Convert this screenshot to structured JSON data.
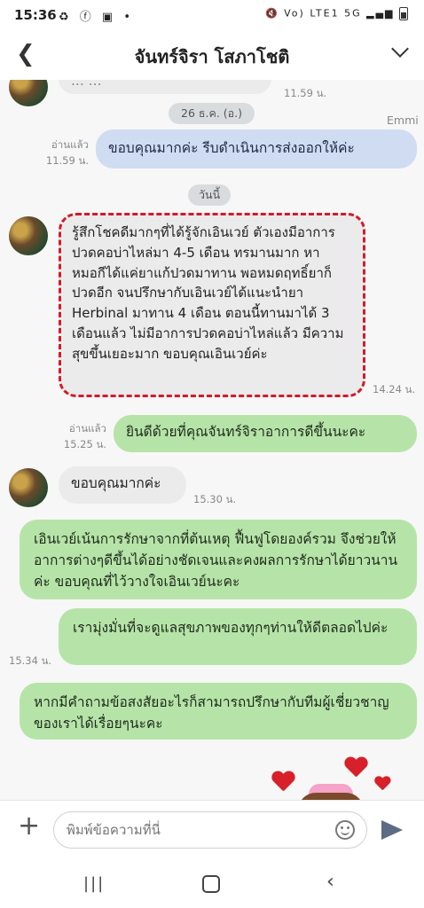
{
  "status": {
    "time": "15:36",
    "left_icons": "♻ ⓕ ▣ •",
    "right_icons": "🔇 Vo) LTE1 5G ▂▄▆"
  },
  "header": {
    "title": "จันทร์จิรา โสภาโชติ"
  },
  "messages": {
    "top_partial": "... ...",
    "top_time": "11.59 น.",
    "date1": "26 ธ.ค. (อ.)",
    "sender_name": "Emmi",
    "out1": {
      "read": "อ่านแล้ว",
      "time": "11.59 น.",
      "text": "ขอบคุณมากค่ะ  รีบดำเนินการส่งออกให้ค่ะ"
    },
    "date2": "วันนี้",
    "in_review": {
      "text": "รู้สึกโชคดีมากๆที่ได้รู้จักเอินเวย์ ตัวเองมีอาการปวดคอบ่าไหล่มา 4-5 เดือน ทรมานมาก หาหมอกีได้แค่ยาแก้ปวดมาทาน พอหมดฤทธิ์ยาก็ปวดอีก จนปรึกษากับเอินเวย์ได้แนะนำยา Herbinal มาทาน 4 เดือน ตอนนี้ทานมาได้ 3 เดือนแล้ว ไม่มีอาการปวดคอบ่าไหล่แล้ว มีความสุขขึ้นเยอะมาก ขอบคุณเอินเวย์ค่ะ",
      "time": "14.24 น."
    },
    "out2": {
      "read": "อ่านแล้ว",
      "time": "15.25 น.",
      "text": "ยินดีด้วยที่คุณจันทร์จิราอาการดีขึ้นนะคะ"
    },
    "in2": {
      "text": "ขอบคุณมากค่ะ",
      "time": "15.30 น."
    },
    "out3": {
      "text": "เอินเวย์เน้นการรักษาจากที่ต้นเหตุ ฟื้นฟูโดยองค์รวม จึงช่วยให้อาการต่างๆดีขึ้นได้อย่างชัดเจนและคงผลการรักษาได้ยาวนานค่ะ ขอบคุณที่ไว้วางใจเอินเวย์นะคะ"
    },
    "out4": {
      "text": "เรามุ่งมั่นที่จะดูแลสุขภาพของทุกๆท่านให้ดีตลอดไปค่ะ",
      "time": "15.34 น."
    },
    "out5": {
      "text": "หากมีคำถามข้อสงสัยอะไรก็สามารถปรึกษากับทีมผู้เชี่ยวชาญของเราได้เรื่อยๆนะคะ"
    }
  },
  "composer": {
    "placeholder": "พิมพ์ข้อความที่นี่",
    "plus": "+"
  },
  "navbar": {
    "recents": "|||",
    "back": "‹"
  }
}
